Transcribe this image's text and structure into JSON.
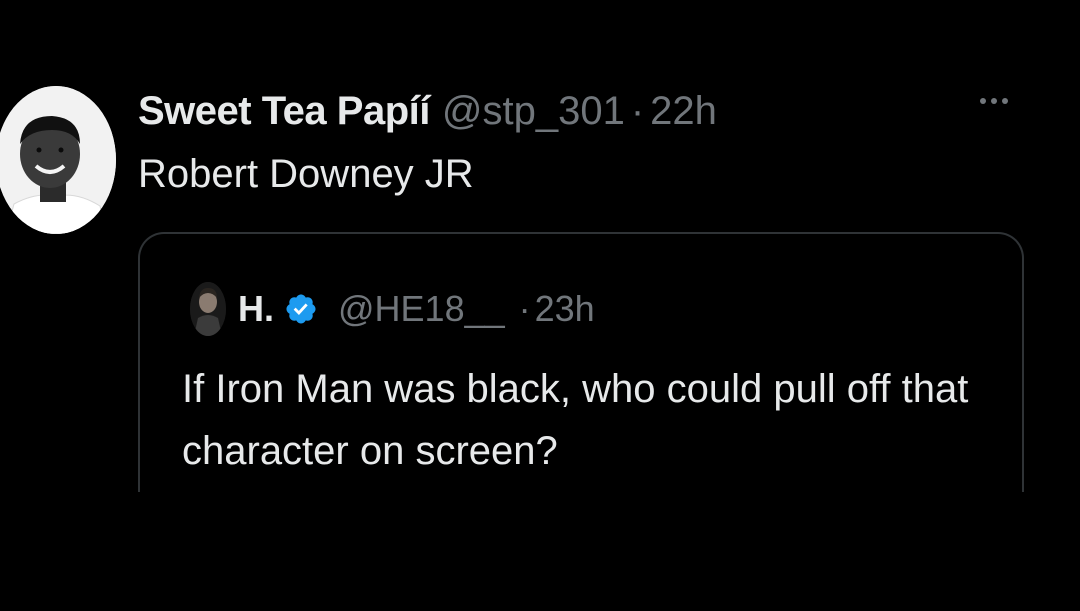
{
  "tweet": {
    "display_name": "Sweet Tea Papíí",
    "handle": "@stp_301",
    "separator": "·",
    "time": "22h",
    "text": "Robert Downey JR",
    "more_icon": "more-horizontal-icon"
  },
  "quoted_tweet": {
    "display_name": "H.",
    "verified_icon": "verified-badge-icon",
    "handle": "@HE18__",
    "separator": "·",
    "time": "23h",
    "text": "If Iron Man was black, who could pull off that character on screen?"
  },
  "colors": {
    "background": "#000000",
    "primary_text": "#e7e9ea",
    "secondary_text": "#71767b",
    "border": "#2f3336",
    "verified": "#1d9bf0"
  }
}
